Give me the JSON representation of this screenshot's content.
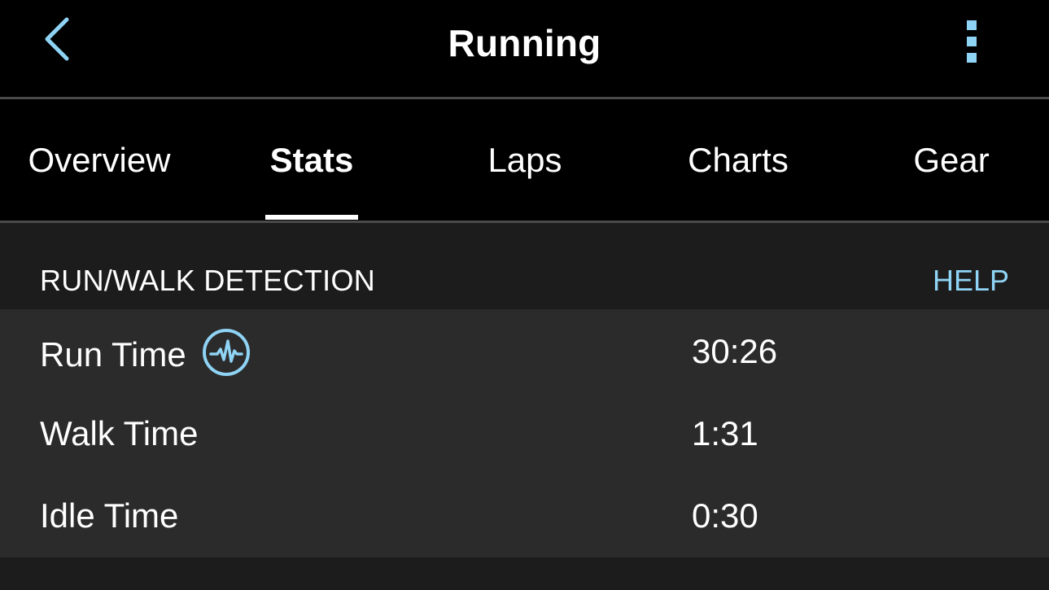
{
  "header": {
    "title": "Running",
    "back_icon": "chevron-left-icon",
    "menu_icon": "kebab-menu-icon"
  },
  "tabs": [
    {
      "label": "Overview",
      "active": false
    },
    {
      "label": "Stats",
      "active": true
    },
    {
      "label": "Laps",
      "active": false
    },
    {
      "label": "Charts",
      "active": false
    },
    {
      "label": "Gear",
      "active": false
    }
  ],
  "section": {
    "title": "RUN/WALK DETECTION",
    "help_label": "HELP"
  },
  "stats": [
    {
      "label": "Run Time",
      "value": "30:26",
      "icon": "heart-pulse-icon"
    },
    {
      "label": "Walk Time",
      "value": "1:31"
    },
    {
      "label": "Idle Time",
      "value": "0:30"
    }
  ],
  "colors": {
    "accent": "#8fd3f5",
    "header_bg": "#000000",
    "list_bg": "#2b2b2b",
    "page_bg": "#1c1c1c"
  }
}
